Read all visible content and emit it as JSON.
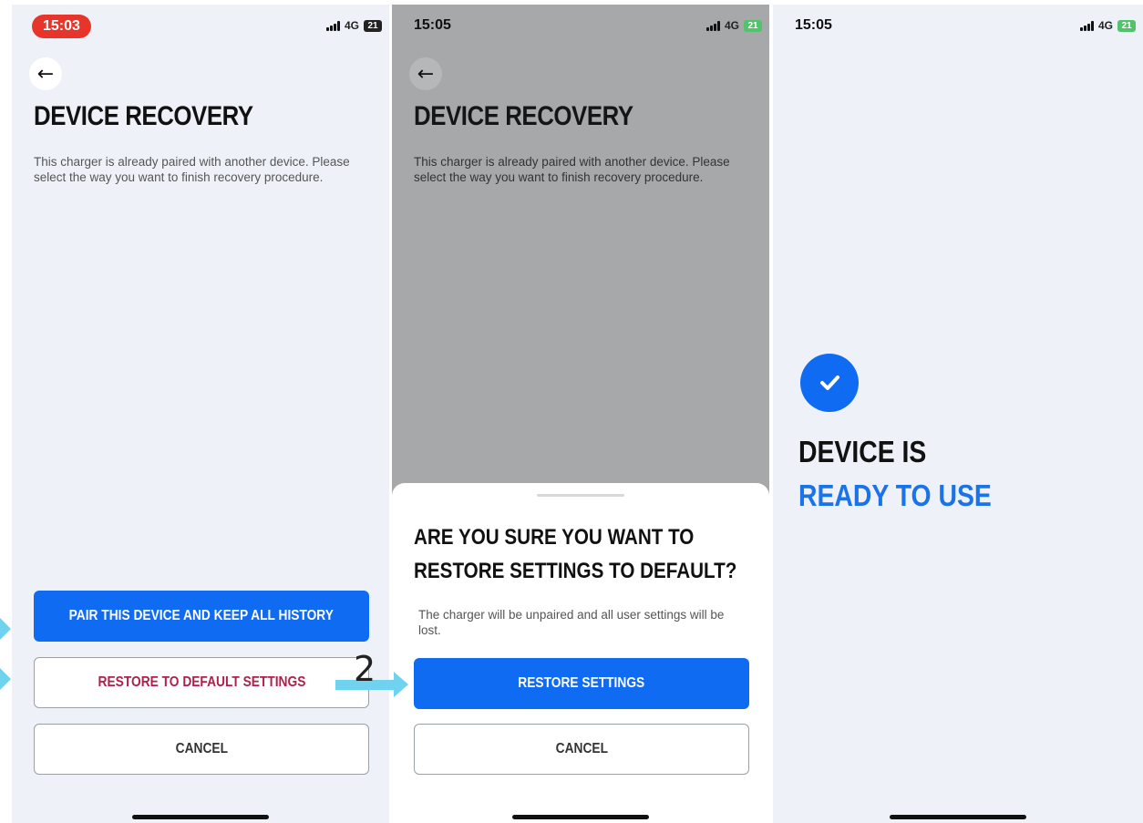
{
  "screen1": {
    "time": "15:03",
    "network": "4G",
    "battery": "21",
    "title": "DEVICE RECOVERY",
    "description": "This charger is already paired with another device. Please select the way you want to finish recovery procedure.",
    "pair_button": "PAIR THIS DEVICE AND KEEP ALL HISTORY",
    "restore_button": "RESTORE TO DEFAULT SETTINGS",
    "cancel_button": "CANCEL"
  },
  "screen2": {
    "time": "15:05",
    "network": "4G",
    "battery": "21",
    "title": "DEVICE RECOVERY",
    "description": "This charger is already paired with another device. Please select the way you want to finish recovery procedure.",
    "sheet_title": "ARE YOU SURE YOU WANT TO RESTORE SETTINGS TO DEFAULT?",
    "sheet_text": "The charger will be unpaired and all user settings will be lost.",
    "restore_button": "RESTORE SETTINGS",
    "cancel_button": "CANCEL"
  },
  "screen3": {
    "time": "15:05",
    "network": "4G",
    "battery": "21",
    "line1": "DEVICE IS",
    "line2": "READY TO USE"
  },
  "annotation": {
    "step_number": "2"
  },
  "colors": {
    "primary": "#0f6bf2",
    "danger_text": "#b0204a",
    "accent_text": "#1a73e8",
    "overlay": "#a7a8aa",
    "arrow": "#6fd2ee",
    "time_pill": "#e8352b"
  }
}
